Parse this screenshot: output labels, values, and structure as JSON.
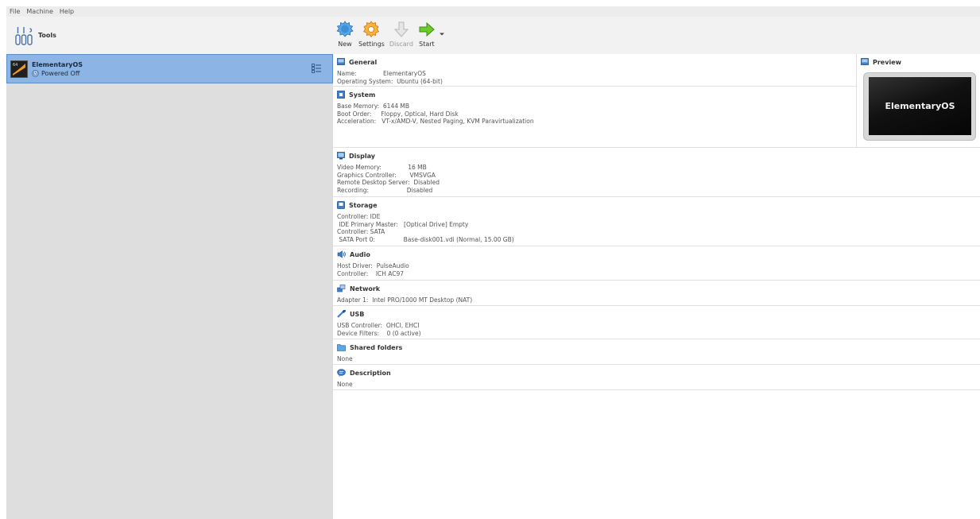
{
  "menu": [
    "File",
    "Machine",
    "Help"
  ],
  "tools": {
    "label": "Tools"
  },
  "vm": {
    "name": "ElementaryOS",
    "state": "Powered Off"
  },
  "toolbar": {
    "new": "New",
    "settings": "Settings",
    "discard": "Discard",
    "start": "Start"
  },
  "sections": {
    "general": {
      "title": "General",
      "rows": [
        "Name:              ElementaryOS",
        "Operating System:  Ubuntu (64-bit)"
      ]
    },
    "system": {
      "title": "System",
      "rows": [
        "Base Memory:  6144 MB",
        "Boot Order:     Floppy, Optical, Hard Disk",
        "Acceleration:   VT-x/AMD-V, Nested Paging, KVM Paravirtualization"
      ]
    },
    "display": {
      "title": "Display",
      "rows": [
        "Video Memory:              16 MB",
        "Graphics Controller:       VMSVGA",
        "Remote Desktop Server:  Disabled",
        "Recording:                    Disabled"
      ]
    },
    "storage": {
      "title": "Storage",
      "rows": [
        "Controller: IDE",
        " IDE Primary Master:   [Optical Drive] Empty",
        "Controller: SATA",
        " SATA Port 0:               Base-disk001.vdi (Normal, 15.00 GB)"
      ]
    },
    "audio": {
      "title": "Audio",
      "rows": [
        "Host Driver:  PulseAudio",
        "Controller:    ICH AC97"
      ]
    },
    "network": {
      "title": "Network",
      "rows": [
        "Adapter 1:  Intel PRO/1000 MT Desktop (NAT)"
      ]
    },
    "usb": {
      "title": "USB",
      "rows": [
        "USB Controller:  OHCI, EHCI",
        "Device Filters:    0 (0 active)"
      ]
    },
    "shared": {
      "title": "Shared folders",
      "rows": [
        "None"
      ]
    },
    "description": {
      "title": "Description",
      "rows": [
        "None"
      ]
    }
  },
  "preview": {
    "title": "Preview",
    "screen_text": "ElementaryOS"
  },
  "colors": {
    "selection": "#8cb4e4",
    "icon_blue": "#3a7bd5",
    "start_green": "#4caf1a",
    "settings_orange": "#f0a020"
  }
}
